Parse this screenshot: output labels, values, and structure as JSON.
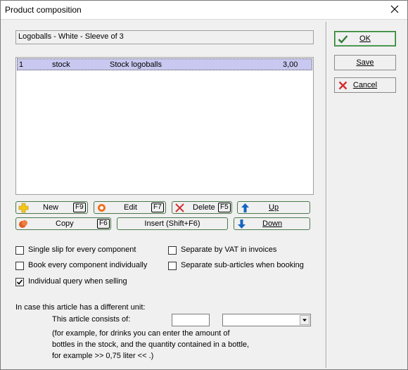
{
  "window": {
    "title": "Product composition"
  },
  "article_name": "Logoballs - White - Sleeve of 3",
  "components": [
    {
      "index": "1",
      "type": "stock",
      "name": "Stock logoballs",
      "quantity": "3,00"
    }
  ],
  "buttons": {
    "new": {
      "label": "New",
      "key": "F9"
    },
    "edit": {
      "label": "Edit",
      "key": "F7"
    },
    "delete": {
      "label": "Delete",
      "key": "F5"
    },
    "up": {
      "label": "Up"
    },
    "copy": {
      "label": "Copy",
      "key": "F6"
    },
    "insert": {
      "label": "Insert (Shift+F6)"
    },
    "down": {
      "label": "Down"
    }
  },
  "options": {
    "single_slip": {
      "label": "Single slip for every component",
      "checked": false
    },
    "separate_vat": {
      "label": "Separate by VAT in invoices",
      "checked": false
    },
    "book_individually": {
      "label": "Book every component individually",
      "checked": false
    },
    "separate_subarticles": {
      "label": "Separate sub-articles when booking",
      "checked": false
    },
    "individual_query": {
      "label": "Individual query when selling",
      "checked": true
    }
  },
  "unit_section": {
    "heading": "In case this article has a different unit:",
    "consists_label": "This article consists of:",
    "quantity_value": "",
    "unit_value": "",
    "hint_line1": "(for example, for drinks you can enter the amount of",
    "hint_line2": "bottles in the stock, and the quantity contained in a bottle,",
    "hint_line3": "for example >> 0,75 liter << .)"
  },
  "side_buttons": {
    "ok": "OK",
    "save": "Save",
    "cancel": "Cancel"
  },
  "colors": {
    "selection": "#c8c8f0",
    "accent_green": "#2e7d32",
    "cancel_red": "#d32f2f",
    "arrow_blue": "#1565c0"
  }
}
